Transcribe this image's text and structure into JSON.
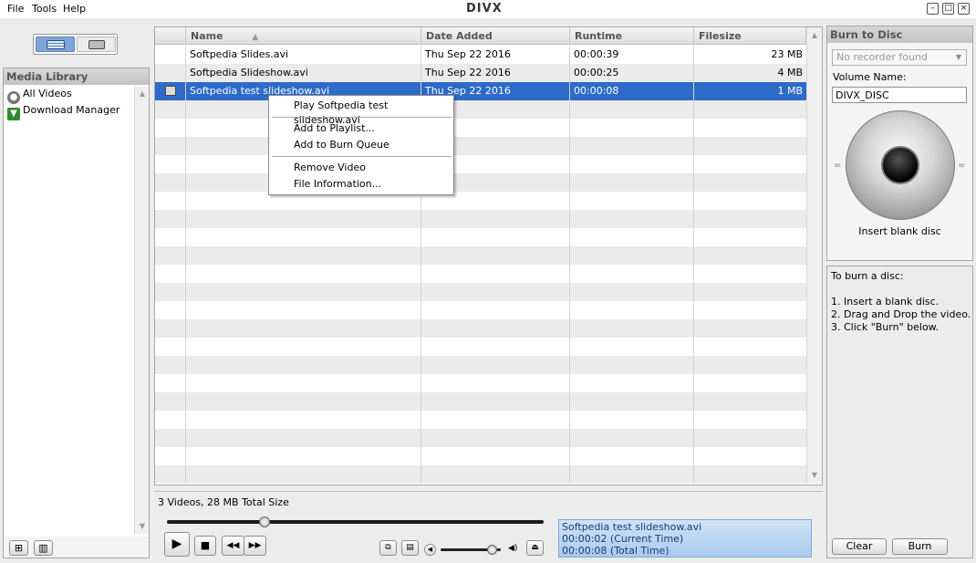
{
  "menu": {
    "file": "File",
    "tools": "Tools",
    "help": "Help"
  },
  "app_logo": "DIVX",
  "window_controls": {
    "minimize": "–",
    "maximize": "□",
    "close": "×"
  },
  "media_library": {
    "title": "Media Library",
    "items": [
      {
        "label": "All Videos",
        "icon": "film-reel-icon"
      },
      {
        "label": "Download Manager",
        "icon": "download-arrow-icon"
      }
    ]
  },
  "table": {
    "columns": [
      "Name",
      "Date Added",
      "Runtime",
      "Filesize"
    ],
    "rows": [
      {
        "name": "Softpedia Slides.avi",
        "date": "Thu Sep 22 2016",
        "runtime": "00:00:39",
        "size": "23 MB"
      },
      {
        "name": "Softpedia Slideshow.avi",
        "date": "Thu Sep 22 2016",
        "runtime": "00:00:25",
        "size": "4 MB"
      },
      {
        "name": "Softpedia test slideshow.avi",
        "date": "Thu Sep 22 2016",
        "runtime": "00:00:08",
        "size": "1 MB"
      }
    ],
    "selected_row": 2
  },
  "context_menu": {
    "play": "Play Softpedia test slideshow.avi",
    "add_playlist": "Add to Playlist...",
    "add_burn": "Add to Burn Queue",
    "remove": "Remove Video",
    "info": "File Information..."
  },
  "status_text": "3 Videos, 28 MB Total Size",
  "player": {
    "now_playing": "Softpedia test slideshow.avi",
    "current_time": "00:00:02  (Current Time)",
    "total_time": "00:00:08  (Total Time)",
    "seek_position": 0.26,
    "volume": 0.85
  },
  "burn": {
    "title": "Burn to Disc",
    "recorder": "No recorder found",
    "volume_label": "Volume Name:",
    "volume_value": "DIVX_DISC",
    "disc_caption": "Insert blank disc",
    "instructions_title": "To burn a disc:",
    "step1": "1. Insert a blank disc.",
    "step2": "2. Drag and Drop the video.",
    "step3": "3. Click \"Burn\" below.",
    "clear_button": "Clear",
    "burn_button": "Burn"
  },
  "colors": {
    "selection": "#2e6bc8",
    "info_panel": "#bcd7f2"
  }
}
